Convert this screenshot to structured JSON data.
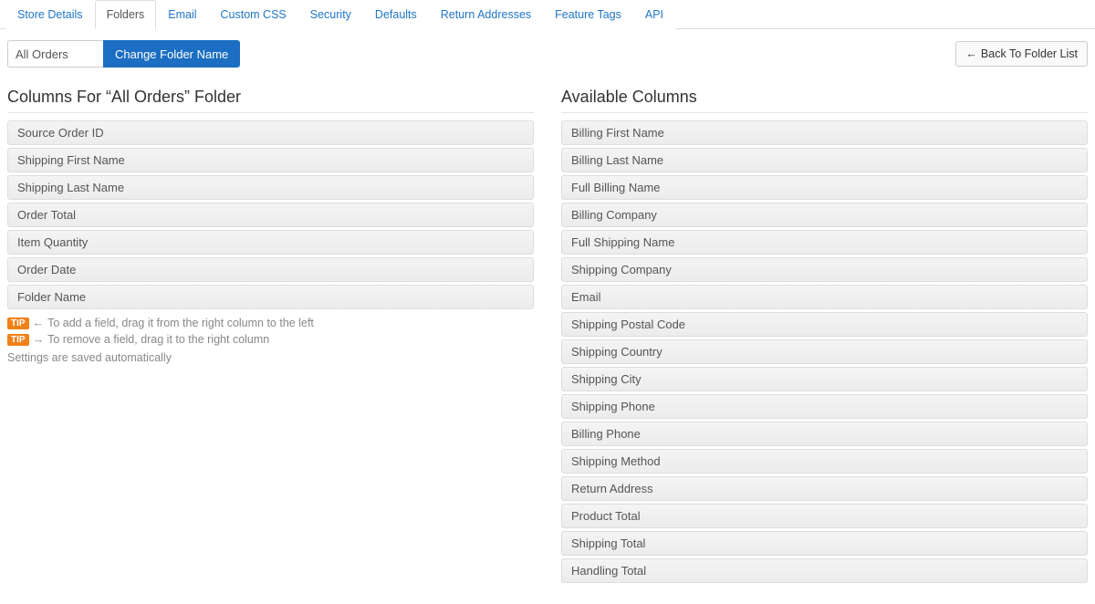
{
  "tabs": [
    {
      "label": "Store Details",
      "active": false
    },
    {
      "label": "Folders",
      "active": true
    },
    {
      "label": "Email",
      "active": false
    },
    {
      "label": "Custom CSS",
      "active": false
    },
    {
      "label": "Security",
      "active": false
    },
    {
      "label": "Defaults",
      "active": false
    },
    {
      "label": "Return Addresses",
      "active": false
    },
    {
      "label": "Feature Tags",
      "active": false
    },
    {
      "label": "API",
      "active": false
    }
  ],
  "toolbar": {
    "folder_name_value": "All Orders",
    "change_button_label": "Change Folder Name",
    "back_button_label": "Back To Folder List"
  },
  "left": {
    "heading": "Columns For “All Orders” Folder",
    "items": [
      "Source Order ID",
      "Shipping First Name",
      "Shipping Last Name",
      "Order Total",
      "Item Quantity",
      "Order Date",
      "Folder Name"
    ],
    "tip_badge": "TIP",
    "tip_add_text": "To add a field, drag it from the right column to the left",
    "tip_remove_text": "To remove a field, drag it to the right column",
    "autosave_text": "Settings are saved automatically"
  },
  "right": {
    "heading": "Available Columns",
    "items": [
      "Billing First Name",
      "Billing Last Name",
      "Full Billing Name",
      "Billing Company",
      "Full Shipping Name",
      "Shipping Company",
      "Email",
      "Shipping Postal Code",
      "Shipping Country",
      "Shipping City",
      "Shipping Phone",
      "Billing Phone",
      "Shipping Method",
      "Return Address",
      "Product Total",
      "Shipping Total",
      "Handling Total"
    ]
  }
}
